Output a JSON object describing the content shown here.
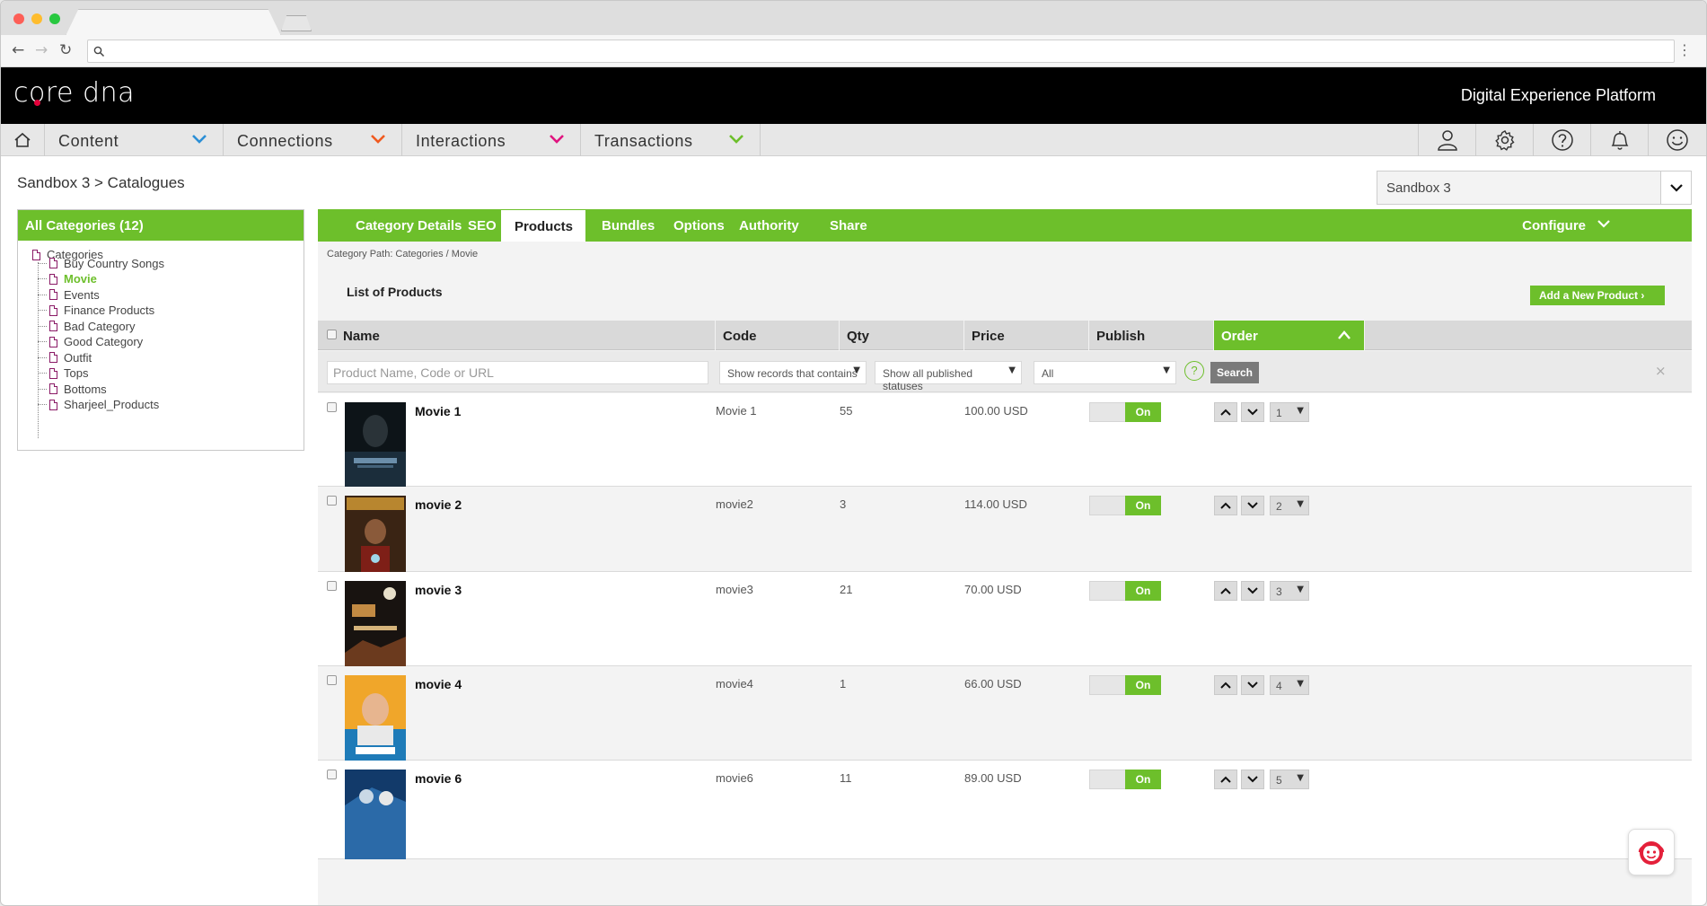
{
  "header": {
    "logo_text": "core dna",
    "tagline": "Digital Experience Platform"
  },
  "nav": [
    {
      "label": "Content",
      "chevron_color": "#2b8fd6"
    },
    {
      "label": "Connections",
      "chevron_color": "#f05a1f"
    },
    {
      "label": "Interactions",
      "chevron_color": "#e0147f"
    },
    {
      "label": "Transactions",
      "chevron_color": "#6dbf2b"
    }
  ],
  "nav_icons": [
    "user-icon",
    "gear-icon",
    "help-icon",
    "bell-icon",
    "smiley-icon"
  ],
  "breadcrumb": "Sandbox 3 > Catalogues",
  "site_select": {
    "value": "Sandbox 3"
  },
  "tree": {
    "header": "All Categories (12)",
    "root": "Categories",
    "items": [
      {
        "label": "Buy Country Songs",
        "active": false
      },
      {
        "label": "Movie",
        "active": true
      },
      {
        "label": "Events",
        "active": false
      },
      {
        "label": "Finance Products",
        "active": false
      },
      {
        "label": "Bad Category",
        "active": false
      },
      {
        "label": "Good Category",
        "active": false
      },
      {
        "label": "Outfit",
        "active": false
      },
      {
        "label": "Tops",
        "active": false
      },
      {
        "label": "Bottoms",
        "active": false
      },
      {
        "label": "Sharjeel_Products",
        "active": false
      }
    ]
  },
  "tabs": [
    "Category Details",
    "SEO",
    "Products",
    "Bundles",
    "Options",
    "Authority",
    "Share"
  ],
  "active_tab": "Products",
  "configure_label": "Configure",
  "category_path": "Category Path:  Categories  /  Movie",
  "list_title": "List of Products",
  "add_button": "Add a New Product  ›",
  "columns": [
    "Name",
    "Code",
    "Qty",
    "Price",
    "Publish",
    "Order"
  ],
  "filters": {
    "search_placeholder": "Product Name, Code or URL",
    "code_filter": "Show records that contains",
    "publish_filter": "Show all published statuses",
    "price_filter": "All",
    "help": "?",
    "search_button": "Search",
    "clear": "×"
  },
  "products": [
    {
      "name": "Movie 1",
      "code": "Movie 1",
      "qty": "55",
      "price": "100.00 USD",
      "publish": "On",
      "order": "1"
    },
    {
      "name": "movie 2",
      "code": "movie2",
      "qty": "3",
      "price": "114.00 USD",
      "publish": "On",
      "order": "2"
    },
    {
      "name": "movie 3",
      "code": "movie3",
      "qty": "21",
      "price": "70.00 USD",
      "publish": "On",
      "order": "3"
    },
    {
      "name": "movie 4",
      "code": "movie4",
      "qty": "1",
      "price": "66.00 USD",
      "publish": "On",
      "order": "4"
    },
    {
      "name": "movie 6",
      "code": "movie6",
      "qty": "11",
      "price": "89.00 USD",
      "publish": "On",
      "order": "5"
    }
  ],
  "colors": {
    "accent": "#6dbf2b",
    "header_bg": "#000000",
    "chat_red": "#e4203a"
  }
}
